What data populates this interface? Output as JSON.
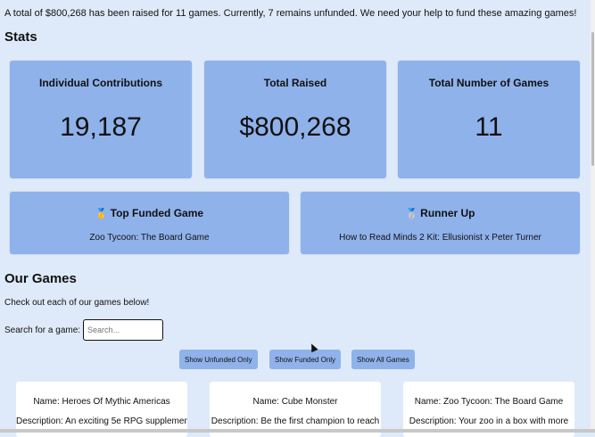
{
  "intro": "A total of $800,268 has been raised for 11 games. Currently, 7 remains unfunded. We need your help to fund these amazing games!",
  "stats": {
    "title": "Stats",
    "cards": [
      {
        "label": "Individual Contributions",
        "value": "19,187"
      },
      {
        "label": "Total Raised",
        "value": "$800,268"
      },
      {
        "label": "Total Number of Games",
        "value": "11"
      }
    ],
    "top": {
      "icon": "🥇",
      "label": "Top Funded Game",
      "value": "Zoo Tycoon: The Board Game"
    },
    "runner": {
      "icon": "🥈",
      "label": "Runner Up",
      "value": "How to Read Minds 2 Kit: Ellusionist x Peter Turner"
    }
  },
  "games": {
    "title": "Our Games",
    "subtitle": "Check out each of our games below!",
    "search_label": "Search for a game:",
    "search_placeholder": "Search...",
    "buttons": {
      "unfunded": "Show Unfunded Only",
      "funded": "Show Funded Only",
      "all": "Show All Games"
    },
    "cards": [
      {
        "name": "Name: Heroes Of Mythic Americas",
        "desc": "Description: An exciting 5e RPG supplement"
      },
      {
        "name": "Name: Cube Monster",
        "desc": "Description: Be the first champion to reach"
      },
      {
        "name": "Name: Zoo Tycoon: The Board Game",
        "desc": "Description: Your zoo in a box with more"
      }
    ]
  }
}
